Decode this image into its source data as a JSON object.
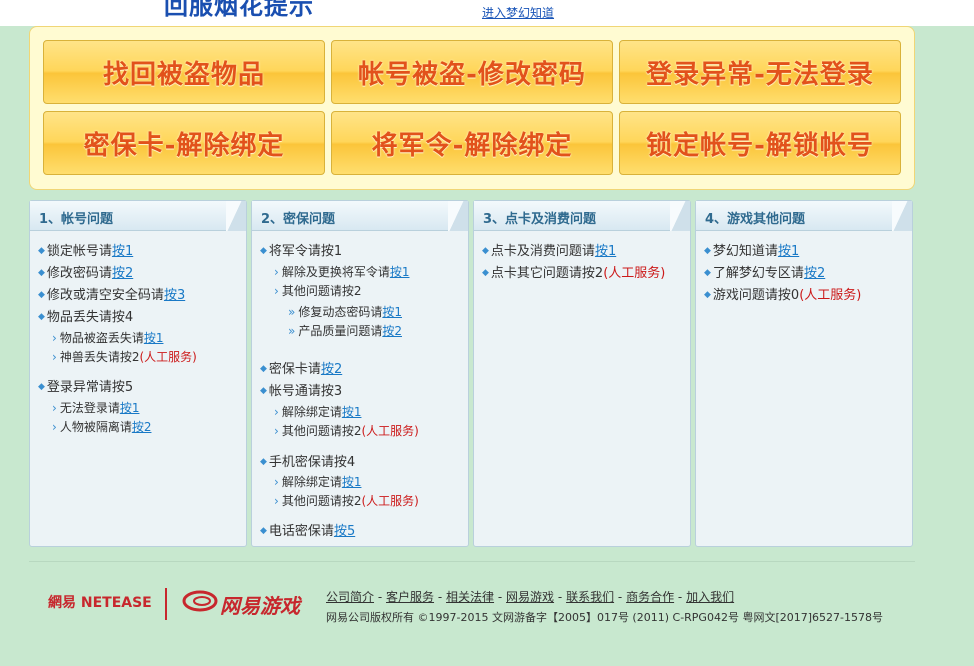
{
  "header": {
    "logo_text": "回服烟花提示",
    "dream_link": "进入梦幻知道"
  },
  "big_buttons": [
    "找回被盗物品",
    "帐号被盗-修改密码",
    "登录异常-无法登录",
    "密保卡-解除绑定",
    "将军令-解除绑定",
    "锁定帐号-解锁帐号"
  ],
  "sections": [
    {
      "title": "1、帐号问题",
      "rows": [
        {
          "text": "锁定帐号请",
          "link": "按1",
          "suffix": ""
        },
        {
          "text": "修改密码请",
          "link": "按2",
          "suffix": ""
        },
        {
          "text": "修改或清空安全码请",
          "link": "按3",
          "suffix": ""
        },
        {
          "text": "物品丢失请按4",
          "link": "",
          "suffix": ""
        },
        {
          "text": "物品被盗丢失请",
          "link": "按1",
          "suffix": ""
        },
        {
          "text": "神兽丢失请按2",
          "link": "",
          "suffix": "(人工服务)"
        },
        {
          "text": "登录异常请按5",
          "link": "",
          "suffix": ""
        },
        {
          "text": "无法登录请",
          "link": "按1",
          "suffix": ""
        },
        {
          "text": "人物被隔离请",
          "link": "按2",
          "suffix": ""
        }
      ]
    },
    {
      "title": "2、密保问题",
      "rows": [
        {
          "text": "将军令请按1",
          "link": "",
          "suffix": ""
        },
        {
          "text": "解除及更换将军令请",
          "link": "按1",
          "suffix": ""
        },
        {
          "text": "其他问题请按2",
          "link": "",
          "suffix": ""
        },
        {
          "text": "修复动态密码请",
          "link": "按1",
          "suffix": ""
        },
        {
          "text": "产品质量问题请",
          "link": "按2",
          "suffix": ""
        },
        {
          "text": "密保卡请",
          "link": "按2",
          "suffix": ""
        },
        {
          "text": "帐号通请按3",
          "link": "",
          "suffix": ""
        },
        {
          "text": "解除绑定请",
          "link": "按1",
          "suffix": ""
        },
        {
          "text": "其他问题请按2",
          "link": "",
          "suffix": "(人工服务)"
        },
        {
          "text": "手机密保请按4",
          "link": "",
          "suffix": ""
        },
        {
          "text": "解除绑定请",
          "link": "按1",
          "suffix": ""
        },
        {
          "text": "其他问题请按2",
          "link": "",
          "suffix": "(人工服务)"
        },
        {
          "text": "电话密保请",
          "link": "按5",
          "suffix": ""
        }
      ]
    },
    {
      "title": "3、点卡及消费问题",
      "rows": [
        {
          "text": "点卡及消费问题请",
          "link": "按1",
          "suffix": ""
        },
        {
          "text": "点卡其它问题请按2",
          "link": "",
          "suffix": "(人工服务)"
        }
      ]
    },
    {
      "title": "4、游戏其他问题",
      "rows": [
        {
          "text": "梦幻知道请",
          "link": "按1",
          "suffix": ""
        },
        {
          "text": "了解梦幻专区请",
          "link": "按2",
          "suffix": ""
        },
        {
          "text": "游戏问题请按0",
          "link": "",
          "suffix": "(人工服务)"
        }
      ]
    }
  ],
  "footer": {
    "netease_logo": "網易 NETEASE",
    "game_logo": "网易游戏",
    "links": [
      "公司简介",
      "客户服务",
      "相关法律",
      "网易游戏",
      "联系我们",
      "商务合作",
      "加入我们"
    ],
    "separator": "-",
    "copyright": "网易公司版权所有 ©1997-2015  文网游备字【2005】017号 (2011) C-RPG042号  粤网文[2017]6527-1578号"
  },
  "colors": {
    "page_bg": "#c8e8cf",
    "button_text": "#e2521b",
    "link": "#1979c6",
    "red": "#cc1a1a",
    "brand_red": "#c7272d"
  }
}
